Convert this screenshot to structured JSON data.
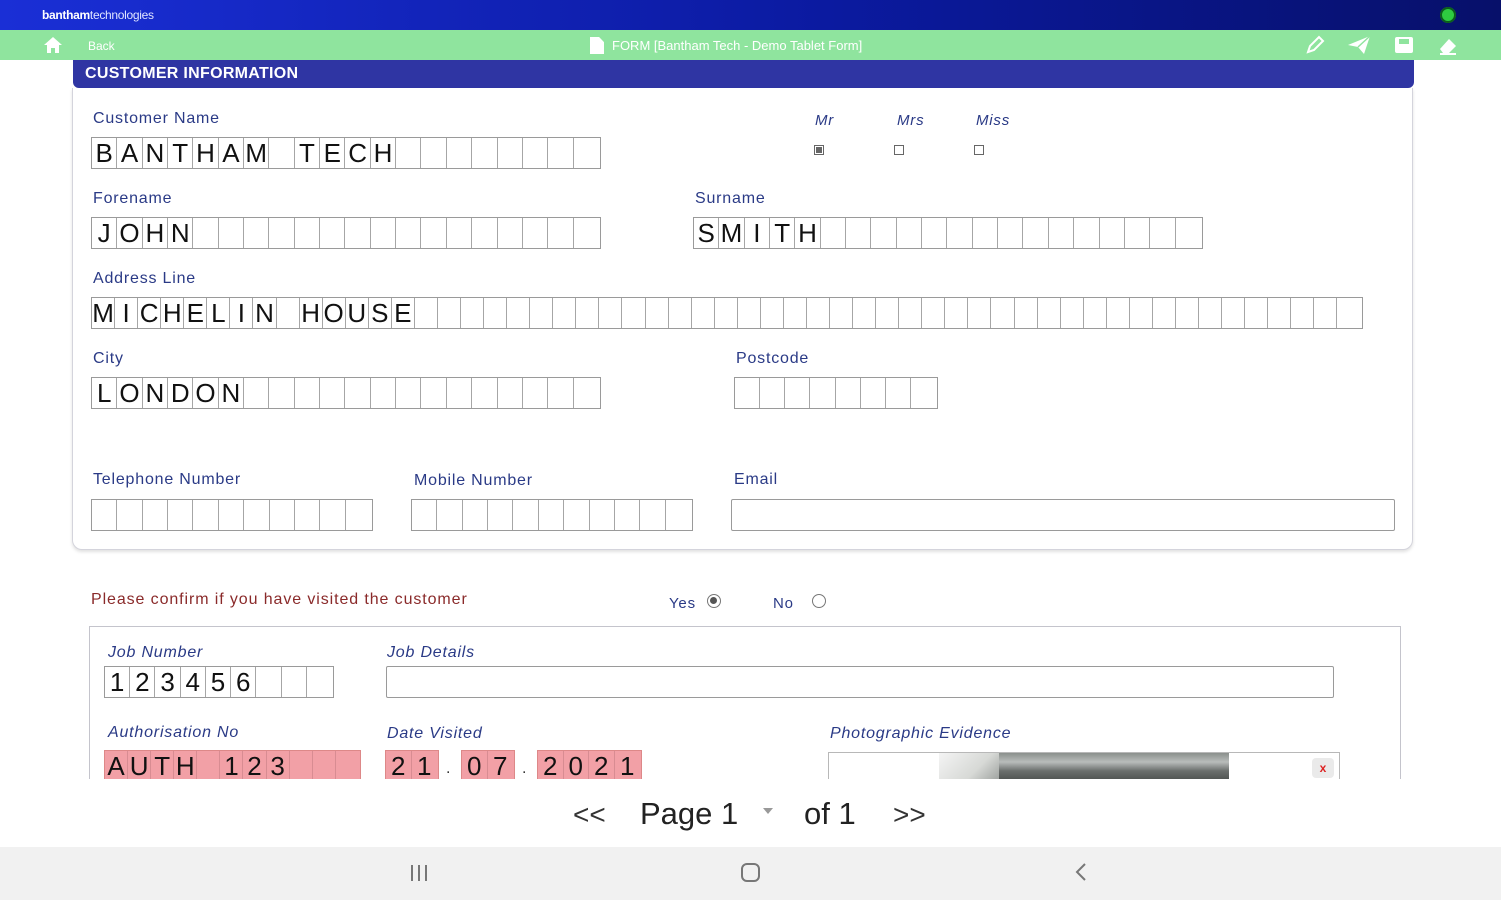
{
  "app": {
    "brand_bold": "bantham",
    "brand_light": "technologies"
  },
  "toolbar": {
    "back_label": "Back",
    "form_title": "FORM [Bantham Tech - Demo Tablet Form]",
    "icons": [
      "home-icon",
      "pen-icon",
      "send-icon",
      "save-icon",
      "erase-icon"
    ]
  },
  "section": {
    "title": "CUSTOMER INFORMATION"
  },
  "customer": {
    "name_label": "Customer Name",
    "name_chars": [
      "B",
      "A",
      "N",
      "T",
      "H",
      "A",
      "M",
      "",
      "T",
      "E",
      "C",
      "H",
      "",
      "",
      "",
      "",
      "",
      "",
      "",
      ""
    ],
    "title_options": [
      {
        "label": "Mr",
        "checked": true
      },
      {
        "label": "Mrs",
        "checked": false
      },
      {
        "label": "Miss",
        "checked": false
      }
    ],
    "forename_label": "Forename",
    "forename_chars": [
      "J",
      "O",
      "H",
      "N",
      "",
      "",
      "",
      "",
      "",
      "",
      "",
      "",
      "",
      "",
      "",
      "",
      "",
      "",
      "",
      ""
    ],
    "surname_label": "Surname",
    "surname_chars": [
      "S",
      "M",
      "I",
      "T",
      "H",
      "",
      "",
      "",
      "",
      "",
      "",
      "",
      "",
      "",
      "",
      "",
      "",
      "",
      "",
      ""
    ],
    "address_label": "Address Line",
    "address_chars": [
      "M",
      "I",
      "C",
      "H",
      "E",
      "L",
      "I",
      "N",
      "",
      "H",
      "O",
      "U",
      "S",
      "E",
      "",
      "",
      "",
      "",
      "",
      "",
      "",
      "",
      "",
      "",
      "",
      "",
      "",
      "",
      "",
      "",
      "",
      "",
      "",
      "",
      "",
      "",
      "",
      "",
      "",
      "",
      "",
      "",
      "",
      "",
      "",
      "",
      "",
      "",
      "",
      "",
      "",
      "",
      "",
      "",
      ""
    ],
    "city_label": "City",
    "city_chars": [
      "L",
      "O",
      "N",
      "D",
      "O",
      "N",
      "",
      "",
      "",
      "",
      "",
      "",
      "",
      "",
      "",
      "",
      "",
      "",
      "",
      ""
    ],
    "postcode_label": "Postcode",
    "postcode_chars": [
      "",
      "",
      "",
      "",
      "",
      "",
      "",
      ""
    ],
    "telephone_label": "Telephone Number",
    "telephone_chars": [
      "",
      "",
      "",
      "",
      "",
      "",
      "",
      "",
      "",
      "",
      ""
    ],
    "mobile_label": "Mobile Number",
    "mobile_chars": [
      "",
      "",
      "",
      "",
      "",
      "",
      "",
      "",
      "",
      "",
      ""
    ],
    "email_label": "Email",
    "email_value": ""
  },
  "visit": {
    "question": "Please confirm if you have visited the customer",
    "yes_label": "Yes",
    "no_label": "No",
    "selected": "Yes"
  },
  "job": {
    "number_label": "Job Number",
    "number_chars": [
      "1",
      "2",
      "3",
      "4",
      "5",
      "6",
      "",
      "",
      ""
    ],
    "details_label": "Job Details",
    "details_value": "",
    "auth_label": "Authorisation No",
    "auth_chars": [
      "A",
      "U",
      "T",
      "H",
      "",
      "1",
      "2",
      "3",
      "",
      "",
      ""
    ],
    "date_label": "Date Visited",
    "date_day": [
      "2",
      "1"
    ],
    "date_month": [
      "0",
      "7"
    ],
    "date_year": [
      "2",
      "0",
      "2",
      "1"
    ],
    "date_sep": ".",
    "photo_label": "Photographic Evidence",
    "photo_delete": "x"
  },
  "pager": {
    "prev": "<<",
    "page_label": "Page 1",
    "of_label": "of 1",
    "next": ">>"
  },
  "colors": {
    "brand_blue": "#1a2fd6",
    "toolbar_green": "#8fe49e",
    "header_blue": "#2f35a3",
    "label_blue": "#2a3a86",
    "required_pink": "#f2a0a6",
    "confirm_red": "#8a2a2a"
  }
}
